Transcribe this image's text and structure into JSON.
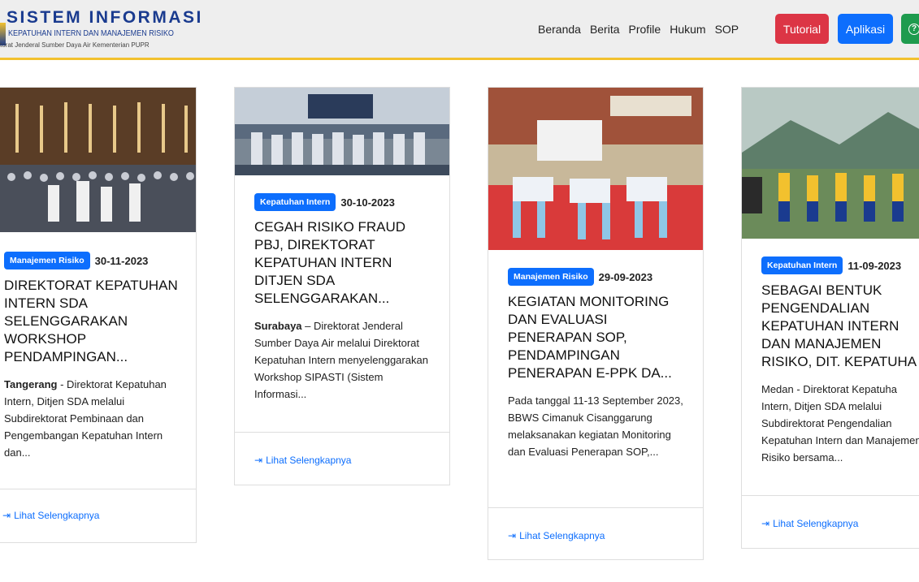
{
  "header": {
    "brand_title": "SISTEM INFORMASI",
    "brand_subtitle": "KEPATUHAN INTERN DAN MANAJEMEN RISIKO",
    "brand_org": "torat Jenderal Sumber Daya Air Kementerian PUPR",
    "nav": [
      "Beranda",
      "Berita",
      "Profile",
      "Hukum",
      "SOP"
    ],
    "btn_tutorial": "Tutorial",
    "btn_aplikasi": "Aplikasi",
    "help_icon": "question-circle-icon",
    "accent_yellow": "#f2c12e",
    "accent_blue": "#0d6efd",
    "accent_red": "#dc3545",
    "accent_green": "#1e9b4e"
  },
  "cards": [
    {
      "badge": "Manajemen Risiko",
      "date": "30-11-2023",
      "title": "DIREKTORAT KEPATUHAN INTERN SDA SELENGGARAKAN WORKSHOP PENDAMPINGAN...",
      "excerpt_lead": "Tangerang",
      "excerpt": " - Direktorat Kepatuhan Intern, Ditjen SDA melalui Subdirektorat Pembinaan dan Pengembangan Kepatuhan Intern dan...",
      "more": "Lihat Selengkapnya"
    },
    {
      "badge": "Kepatuhan Intern",
      "date": "30-10-2023",
      "title": "CEGAH RISIKO FRAUD PBJ, DIREKTORAT KEPATUHAN INTERN DITJEN SDA SELENGGARAKAN...",
      "excerpt_lead": "Surabaya",
      "excerpt": " – Direktorat Jenderal Sumber Daya Air melalui Direktorat Kepatuhan Intern menyelenggarakan Workshop SIPASTI (Sistem Informasi...",
      "more": "Lihat Selengkapnya"
    },
    {
      "badge": "Manajemen Risiko",
      "date": "29-09-2023",
      "title": "KEGIATAN MONITORING DAN EVALUASI PENERAPAN SOP, PENDAMPINGAN PENERAPAN E-PPK DA...",
      "excerpt_lead": "",
      "excerpt": "Pada tanggal 11-13 September 2023, BBWS Cimanuk Cisanggarung melaksanakan kegiatan Monitoring dan Evaluasi Penerapan SOP,...",
      "more": "Lihat Selengkapnya"
    },
    {
      "badge": "Kepatuhan Intern",
      "date": "11-09-2023",
      "title": "SEBAGAI BENTUK PENGENDALIAN KEPATUHAN INTERN DAN MANAJEMEN RISIKO, DIT. KEPATUHA",
      "excerpt_lead": "",
      "excerpt": "Medan - Direktorat Kepatuha Intern, Ditjen SDA melalui Subdirektorat Pengendalian Kepatuhan Intern dan Manajemen Risiko bersama...",
      "more": "Lihat Selengkapnya"
    }
  ]
}
